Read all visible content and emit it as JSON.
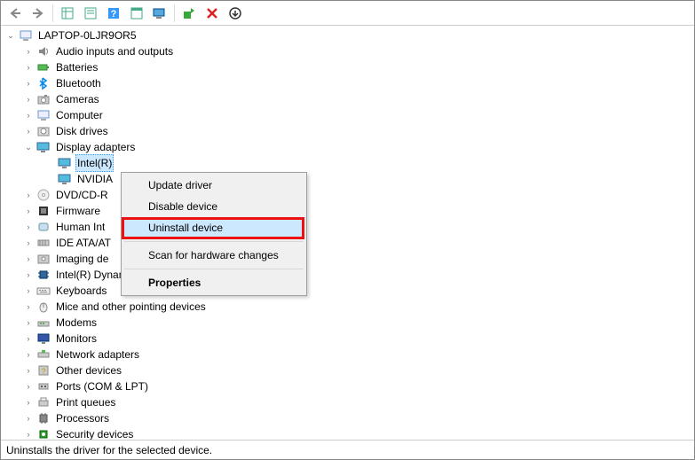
{
  "toolbar": {
    "back": "back-icon",
    "forward": "forward-icon"
  },
  "root": {
    "name": "LAPTOP-0LJR9OR5",
    "expanded": true
  },
  "categories": [
    {
      "label": "Audio inputs and outputs",
      "icon": "speaker-icon",
      "expanded": false
    },
    {
      "label": "Batteries",
      "icon": "battery-icon",
      "expanded": false
    },
    {
      "label": "Bluetooth",
      "icon": "bluetooth-icon",
      "expanded": false
    },
    {
      "label": "Cameras",
      "icon": "camera-icon",
      "expanded": false
    },
    {
      "label": "Computer",
      "icon": "computer-icon",
      "expanded": false
    },
    {
      "label": "Disk drives",
      "icon": "disk-icon",
      "expanded": false
    },
    {
      "label": "Display adapters",
      "icon": "display-icon",
      "expanded": true,
      "children": [
        {
          "label": "Intel(R)",
          "icon": "display-icon",
          "selected": true
        },
        {
          "label": "NVIDIA",
          "icon": "display-icon",
          "selected": false
        }
      ]
    },
    {
      "label": "DVD/CD-R",
      "icon": "dvd-icon",
      "expanded": false,
      "truncated": true
    },
    {
      "label": "Firmware",
      "icon": "firmware-icon",
      "expanded": false
    },
    {
      "label": "Human Int",
      "icon": "hid-icon",
      "expanded": false,
      "truncated": true
    },
    {
      "label": "IDE ATA/AT",
      "icon": "ide-icon",
      "expanded": false,
      "truncated": true
    },
    {
      "label": "Imaging de",
      "icon": "imaging-icon",
      "expanded": false,
      "truncated": true
    },
    {
      "label": "Intel(R) Dynamic Platform and Thermal Framework",
      "icon": "chip-icon",
      "expanded": false
    },
    {
      "label": "Keyboards",
      "icon": "keyboard-icon",
      "expanded": false
    },
    {
      "label": "Mice and other pointing devices",
      "icon": "mouse-icon",
      "expanded": false
    },
    {
      "label": "Modems",
      "icon": "modem-icon",
      "expanded": false
    },
    {
      "label": "Monitors",
      "icon": "monitor-icon",
      "expanded": false
    },
    {
      "label": "Network adapters",
      "icon": "network-icon",
      "expanded": false
    },
    {
      "label": "Other devices",
      "icon": "other-icon",
      "expanded": false
    },
    {
      "label": "Ports (COM & LPT)",
      "icon": "port-icon",
      "expanded": false
    },
    {
      "label": "Print queues",
      "icon": "printer-icon",
      "expanded": false
    },
    {
      "label": "Processors",
      "icon": "cpu-icon",
      "expanded": false
    },
    {
      "label": "Security devices",
      "icon": "security-icon",
      "expanded": false
    }
  ],
  "contextMenu": {
    "items": [
      {
        "label": "Update driver",
        "highlighted": false
      },
      {
        "label": "Disable device",
        "highlighted": false
      },
      {
        "label": "Uninstall device",
        "highlighted": true
      },
      {
        "type": "sep"
      },
      {
        "label": "Scan for hardware changes",
        "highlighted": false
      },
      {
        "type": "sep"
      },
      {
        "label": "Properties",
        "highlighted": false,
        "bold": true
      }
    ]
  },
  "statusBar": {
    "text": "Uninstalls the driver for the selected device."
  }
}
